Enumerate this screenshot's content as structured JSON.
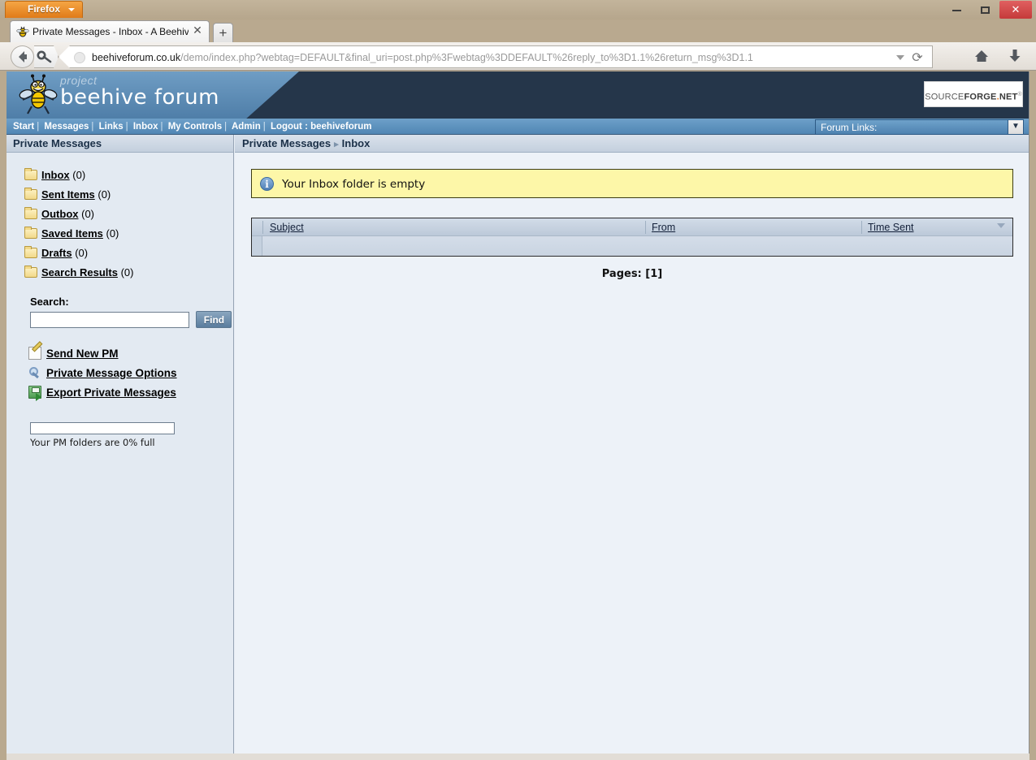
{
  "browser": {
    "app_button": "Firefox",
    "window_controls": {
      "minimize": "minimize",
      "maximize": "maximize",
      "close": "✕"
    },
    "tab": {
      "title": "Private Messages - Inbox - A Beehive ...",
      "close": "✕",
      "new_tab": "+",
      "favicon": "bee-favicon"
    },
    "url": {
      "domain": "beehiveforum.co.uk",
      "path": "/demo/index.php?webtag=DEFAULT&final_uri=post.php%3Fwebtag%3DDEFAULT%26reply_to%3D1.1%26return_msg%3D1.1",
      "full": "beehiveforum.co.uk/demo/index.php?webtag=DEFAULT&final_uri=post.php%3Fwebtag%3DDEFAULT%26reply_to%3D1.1%26return_msg%3D1.1"
    },
    "toolbar": {
      "back": "back-arrow",
      "key": "key-icon",
      "dropdown": "chevron-down-icon",
      "reload": "⟳",
      "home": "⌂",
      "downloads": "⬇"
    }
  },
  "forum": {
    "logo": {
      "tagline": "project",
      "name": "beehive forum"
    },
    "sourceforge": {
      "prefix": "SOURCE",
      "bold": "FORGE",
      "dot": ".",
      "suffix": "NET",
      "tm": "®"
    },
    "nav": [
      {
        "label": "Start"
      },
      {
        "label": "Messages"
      },
      {
        "label": "Links"
      },
      {
        "label": "Inbox"
      },
      {
        "label": "My Controls"
      },
      {
        "label": "Admin"
      },
      {
        "label": "Logout : beehiveforum"
      }
    ],
    "nav_separator": "|",
    "forum_links": {
      "label": "Forum Links:",
      "arrow": "▼"
    }
  },
  "sidebar": {
    "title": "Private Messages",
    "folders": [
      {
        "label": "Inbox",
        "count": "(0)",
        "icon": "folder-icon"
      },
      {
        "label": "Sent Items",
        "count": "(0)",
        "icon": "folder-icon"
      },
      {
        "label": "Outbox",
        "count": "(0)",
        "icon": "folder-icon"
      },
      {
        "label": "Saved Items",
        "count": "(0)",
        "icon": "folder-icon"
      },
      {
        "label": "Drafts",
        "count": "(0)",
        "icon": "folder-icon"
      },
      {
        "label": "Search Results",
        "count": "(0)",
        "icon": "folder-icon"
      }
    ],
    "search": {
      "label": "Search:",
      "value": "",
      "placeholder": "",
      "button": "Find"
    },
    "actions": [
      {
        "label": "Send New PM",
        "icon": "note-pencil-icon"
      },
      {
        "label": "Private Message Options",
        "icon": "wrench-icon"
      },
      {
        "label": "Export Private Messages",
        "icon": "floppy-export-icon"
      }
    ],
    "capacity": {
      "text": "Your PM folders are 0% full",
      "percent": 0
    }
  },
  "content": {
    "breadcrumb": {
      "parent": "Private Messages",
      "separator": "▸",
      "current": "Inbox"
    },
    "notice": {
      "icon": "i",
      "text": "Your Inbox folder is empty"
    },
    "table": {
      "columns": [
        {
          "label": "Subject"
        },
        {
          "label": "From"
        },
        {
          "label": "Time Sent",
          "sorted": "desc"
        }
      ],
      "rows": []
    },
    "pagination": {
      "label": "Pages:",
      "pages": "[1]"
    }
  },
  "colors": {
    "accent_blue": "#5086b4",
    "header_dark": "#25364a",
    "notice_yellow": "#fdf7a8",
    "sourceforge_orange": "#e87722",
    "firefox_orange": "#e07b18"
  }
}
